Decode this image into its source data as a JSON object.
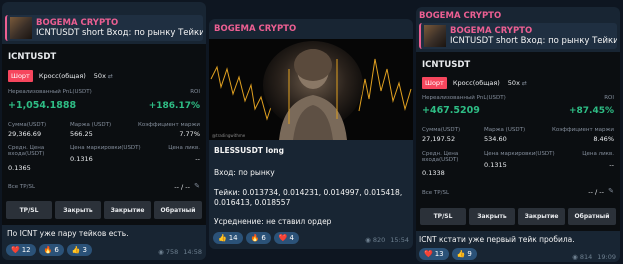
{
  "posts": [
    {
      "reply": {
        "title": "BOGEMA CRYPTO",
        "body": "ICNTUSDT short  Вход: по рынку  Тейки: 0.13..."
      },
      "card": {
        "ticker": "ICNTUSDT",
        "tag_side": "Шорт",
        "tag_margin": "Кросс(общая)",
        "tag_leverage": "50x",
        "pnl_label": "Нереализованный PnL(USDT)",
        "roi_label": "ROI",
        "pnl": "+1,054.1888",
        "roi": "+186.17%",
        "size_label": "Сумма(USDT)",
        "size": "29,366.69",
        "margin_label": "Маржа (USDT)",
        "margin": "566.25",
        "ratio_label": "Коэффициент маржи",
        "ratio": "7.77%",
        "entry_label": "Средн. Цена входа(USDT)",
        "entry": "0.1365",
        "mark_label": "Цена маркировки(USDT)",
        "mark": "0.1316",
        "liq_label": "Цена ликв.",
        "liq": "--",
        "tpsl_label": "Все TP/SL",
        "tpsl": "-- / --",
        "buttons": [
          "TP/SL",
          "Закрыть",
          "Закрытие",
          "Обратный"
        ]
      },
      "caption": "По ICNT уже пару тейков есть.",
      "reactions": [
        {
          "emoji": "❤️",
          "count": "12"
        },
        {
          "emoji": "🔥",
          "count": "6"
        },
        {
          "emoji": "👍",
          "count": "3"
        }
      ],
      "views": "758",
      "time": "14:58"
    },
    {
      "sender": "BOGEMA CRYPTO",
      "image_watermark": "@tradingwithme",
      "title": "BLESSUSDT long",
      "entry": "Вход: по рынку",
      "takes": "Тейки: 0.013734, 0.014231, 0.014997, 0.015418, 0.016413, 0.018557",
      "note": "Усреднение: не ставил ордер",
      "reactions": [
        {
          "emoji": "👍",
          "count": "14"
        },
        {
          "emoji": "🔥",
          "count": "6"
        },
        {
          "emoji": "❤️",
          "count": "4"
        }
      ],
      "views": "820",
      "time": "15:54"
    },
    {
      "sender": "BOGEMA CRYPTO",
      "reply": {
        "title": "BOGEMA CRYPTO",
        "body": "ICNTUSDT short  Вход: по рынку  Тейки: 0.13..."
      },
      "card": {
        "ticker": "ICNTUSDT",
        "tag_side": "Шорт",
        "tag_margin": "Кросс(общая)",
        "tag_leverage": "50x",
        "pnl_label": "Нереализованный PnL(USDT)",
        "roi_label": "ROI",
        "pnl": "+467.5209",
        "roi": "+87.45%",
        "size_label": "Сумма(USDT)",
        "size": "27,197.52",
        "margin_label": "Маржа (USDT)",
        "margin": "534.60",
        "ratio_label": "Коэффициент маржи",
        "ratio": "8.46%",
        "entry_label": "Средн. Цена входа(USDT)",
        "entry": "0.1338",
        "mark_label": "Цена маркировки(USDT)",
        "mark": "0.1315",
        "liq_label": "Цена ликв.",
        "liq": "--",
        "tpsl_label": "Все TP/SL",
        "tpsl": "-- / --",
        "buttons": [
          "TP/SL",
          "Закрыть",
          "Закрытие",
          "Обратный"
        ]
      },
      "caption": "ICNT кстати уже первый тейк пробила.",
      "reactions": [
        {
          "emoji": "❤️",
          "count": "13"
        },
        {
          "emoji": "👍",
          "count": "9"
        }
      ],
      "views": "814",
      "time": "19:09"
    }
  ],
  "colors": {
    "background": "#0e1621",
    "bubble": "#182533",
    "accent": "#ec5f92",
    "positive": "#2ebd85",
    "short": "#f6465d",
    "reaction": "#2b5278"
  },
  "icons": [
    "eye-icon",
    "edit-icon"
  ]
}
